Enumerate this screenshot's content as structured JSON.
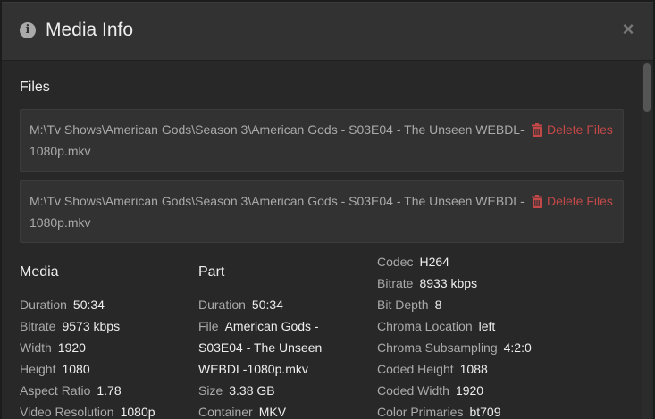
{
  "header": {
    "title": "Media Info",
    "close_glyph": "×",
    "info_icon": "i"
  },
  "files": {
    "heading": "Files",
    "items": [
      {
        "path": "M:\\Tv Shows\\American Gods\\Season 3\\American Gods - S03E04 - The Unseen WEBDL-1080p.mkv",
        "delete_label": "Delete Files"
      },
      {
        "path": "M:\\Tv Shows\\American Gods\\Season 3\\American Gods - S03E04 - The Unseen WEBDL-1080p.mkv",
        "delete_label": "Delete Files"
      }
    ]
  },
  "media": {
    "heading": "Media",
    "rows": [
      {
        "label": "Duration",
        "value": "50:34"
      },
      {
        "label": "Bitrate",
        "value": "9573 kbps"
      },
      {
        "label": "Width",
        "value": "1920"
      },
      {
        "label": "Height",
        "value": "1080"
      },
      {
        "label": "Aspect Ratio",
        "value": "1.78"
      },
      {
        "label": "Video Resolution",
        "value": "1080p"
      }
    ]
  },
  "part": {
    "heading": "Part",
    "duration": {
      "label": "Duration",
      "value": "50:34"
    },
    "file": {
      "label": "File",
      "value": "American Gods - S03E04 - The Unseen WEBDL-1080p.mkv"
    },
    "size": {
      "label": "Size",
      "value": "3.38 GB"
    },
    "container": {
      "label": "Container",
      "value": "MKV"
    }
  },
  "video": {
    "rows": [
      {
        "label": "Codec",
        "value": "H264"
      },
      {
        "label": "Bitrate",
        "value": "8933 kbps"
      },
      {
        "label": "Bit Depth",
        "value": "8"
      },
      {
        "label": "Chroma Location",
        "value": "left"
      },
      {
        "label": "Chroma Subsampling",
        "value": "4:2:0"
      },
      {
        "label": "Coded Height",
        "value": "1088"
      },
      {
        "label": "Coded Width",
        "value": "1920"
      },
      {
        "label": "Color Primaries",
        "value": "bt709"
      }
    ]
  },
  "icons": {
    "info": "info-icon",
    "close": "close-icon",
    "delete": "trash-icon"
  },
  "colors": {
    "delete": "#c44848",
    "label": "#aaaaaa",
    "value": "#eeeeee"
  }
}
